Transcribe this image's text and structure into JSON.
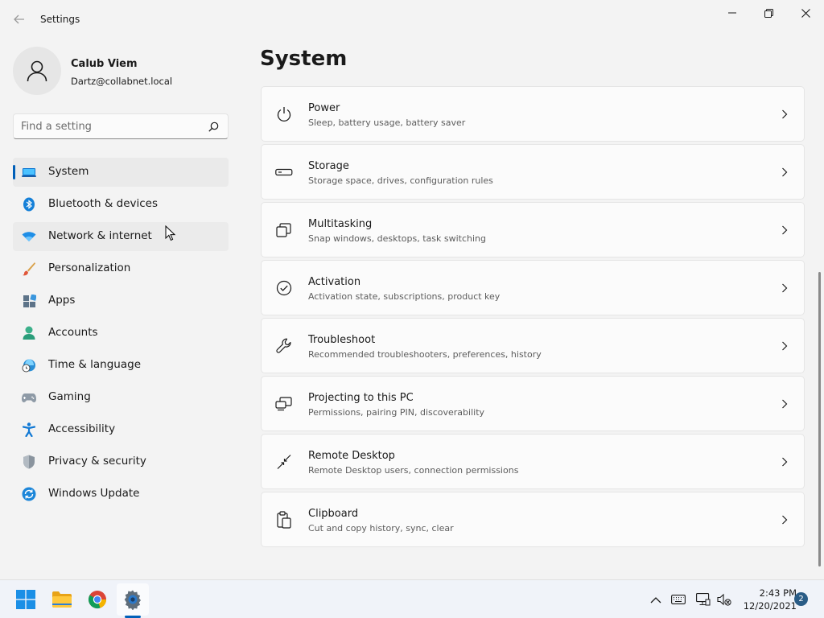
{
  "window": {
    "title": "Settings"
  },
  "profile": {
    "name": "Calub Viem",
    "email": "Dartz@collabnet.local"
  },
  "search": {
    "placeholder": "Find a setting",
    "value": ""
  },
  "sidebar": {
    "items": [
      {
        "label": "System",
        "icon": "laptop-icon",
        "state": "selected"
      },
      {
        "label": "Bluetooth & devices",
        "icon": "bluetooth-icon"
      },
      {
        "label": "Network & internet",
        "icon": "wifi-icon",
        "state": "hover"
      },
      {
        "label": "Personalization",
        "icon": "brush-icon"
      },
      {
        "label": "Apps",
        "icon": "apps-icon"
      },
      {
        "label": "Accounts",
        "icon": "person-icon"
      },
      {
        "label": "Time & language",
        "icon": "globe-clock-icon"
      },
      {
        "label": "Gaming",
        "icon": "gamepad-icon"
      },
      {
        "label": "Accessibility",
        "icon": "accessibility-icon"
      },
      {
        "label": "Privacy & security",
        "icon": "shield-icon"
      },
      {
        "label": "Windows Update",
        "icon": "update-icon"
      }
    ]
  },
  "main": {
    "title": "System",
    "cards": [
      {
        "title": "Power",
        "description": "Sleep, battery usage, battery saver",
        "icon": "power-icon"
      },
      {
        "title": "Storage",
        "description": "Storage space, drives, configuration rules",
        "icon": "storage-drive-icon"
      },
      {
        "title": "Multitasking",
        "description": "Snap windows, desktops, task switching",
        "icon": "multitasking-icon"
      },
      {
        "title": "Activation",
        "description": "Activation state, subscriptions, product key",
        "icon": "check-circle-icon"
      },
      {
        "title": "Troubleshoot",
        "description": "Recommended troubleshooters, preferences, history",
        "icon": "wrench-icon"
      },
      {
        "title": "Projecting to this PC",
        "description": "Permissions, pairing PIN, discoverability",
        "icon": "projecting-icon"
      },
      {
        "title": "Remote Desktop",
        "description": "Remote Desktop users, connection permissions",
        "icon": "remote-desktop-icon"
      },
      {
        "title": "Clipboard",
        "description": "Cut and copy history, sync, clear",
        "icon": "clipboard-icon"
      }
    ]
  },
  "taskbar": {
    "apps": [
      "start-icon",
      "file-explorer-icon",
      "chrome-icon",
      "settings-gear-icon"
    ],
    "active_app": "settings-gear-icon",
    "tray": [
      "chevron-up-icon",
      "keyboard-icon",
      "network-monitor-icon",
      "volume-muted-icon"
    ],
    "time": "2:43 PM",
    "date": "12/20/2021",
    "notification_count": "2"
  },
  "colors": {
    "accent": "#005fb8",
    "background": "#f3f3f3",
    "card": "#fbfbfb"
  }
}
